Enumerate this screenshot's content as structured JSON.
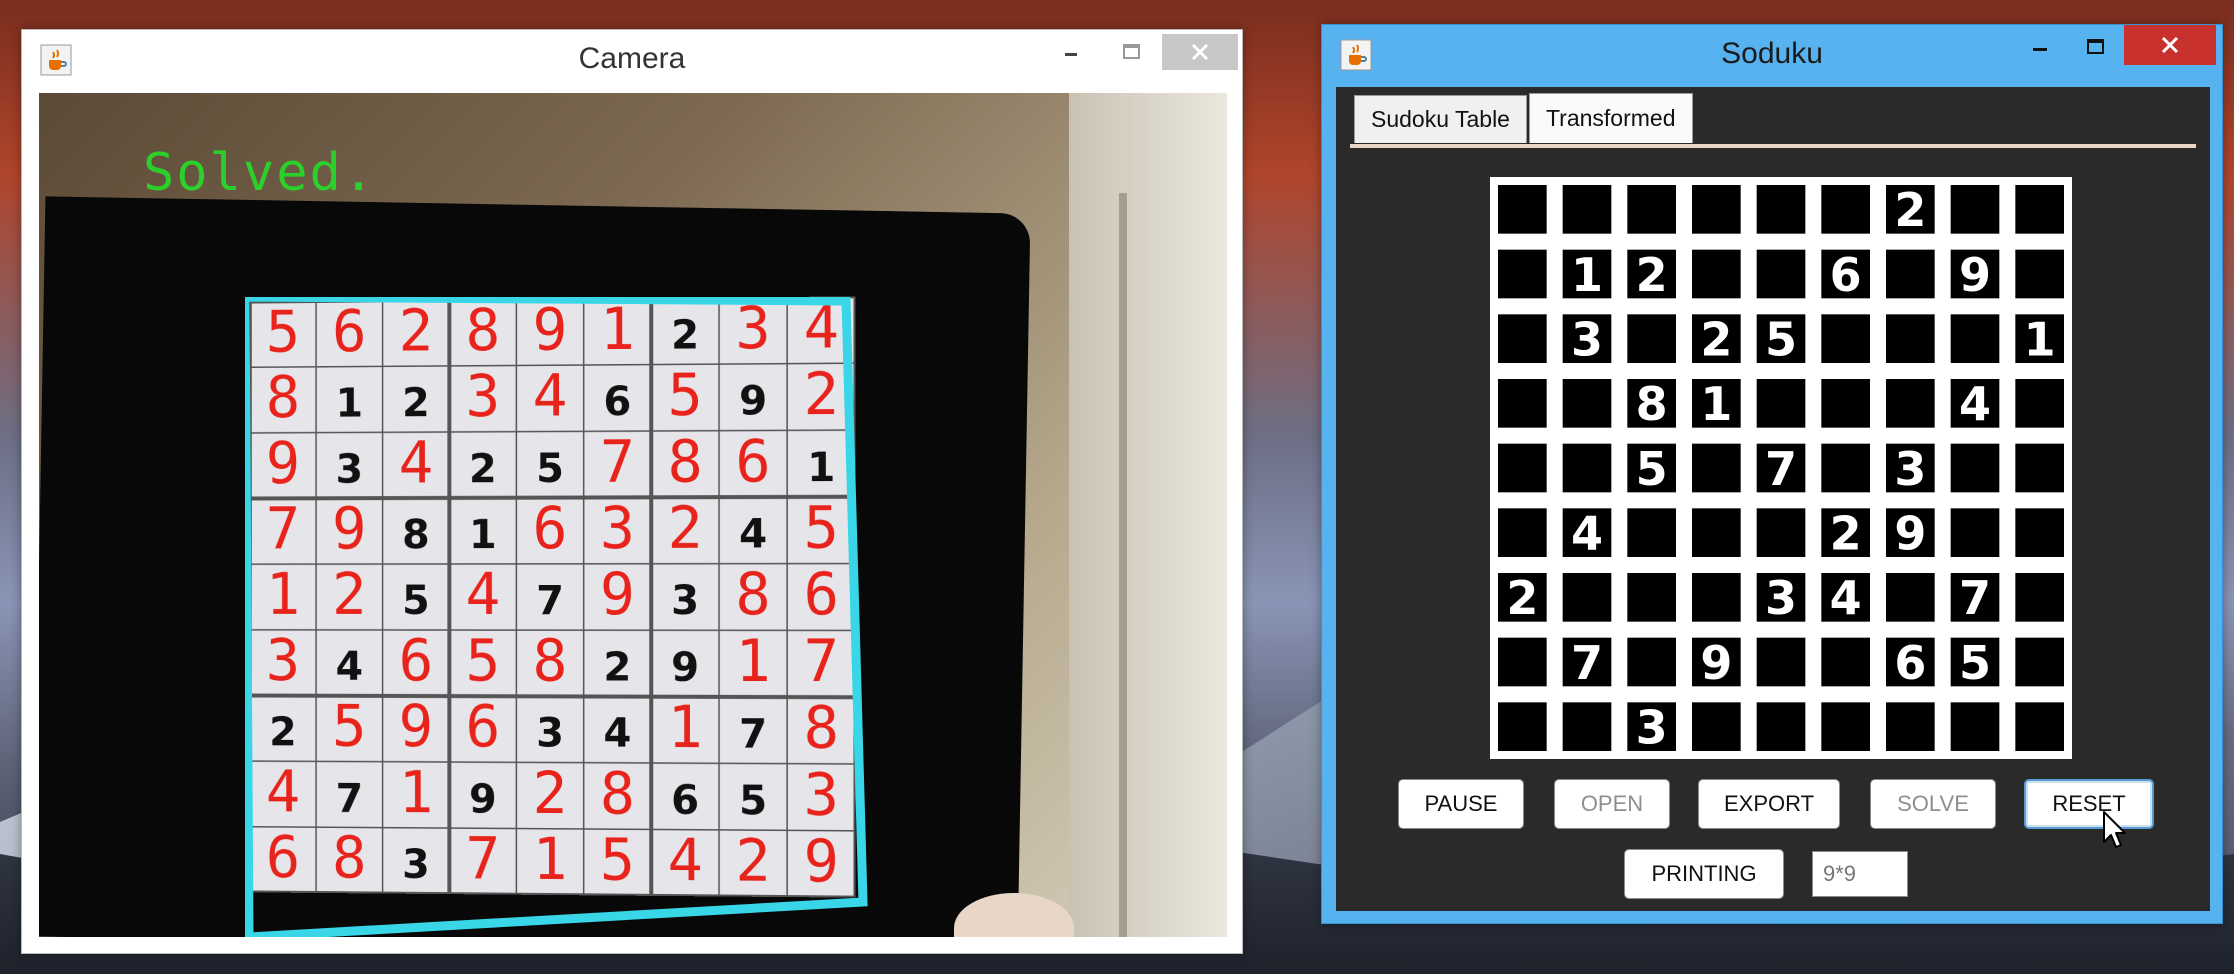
{
  "camera_window": {
    "title": "Camera",
    "overlay_text": "Solved.",
    "sudoku": {
      "printed": [
        [
          "",
          "",
          "",
          "",
          "",
          "",
          "2",
          "",
          ""
        ],
        [
          "",
          "1",
          "2",
          "",
          "",
          "6",
          "",
          "9",
          ""
        ],
        [
          "",
          "3",
          "",
          "2",
          "5",
          "",
          "",
          "",
          "1"
        ],
        [
          "",
          "",
          "8",
          "1",
          "",
          "",
          "",
          "4",
          ""
        ],
        [
          "",
          "",
          "5",
          "",
          "7",
          "",
          "3",
          "",
          ""
        ],
        [
          "",
          "4",
          "",
          "",
          "",
          "2",
          "9",
          "",
          ""
        ],
        [
          "2",
          "",
          "",
          "",
          "3",
          "4",
          "",
          "7",
          ""
        ],
        [
          "",
          "7",
          "",
          "9",
          "",
          "",
          "6",
          "5",
          ""
        ],
        [
          "",
          "",
          "3",
          "",
          "",
          "",
          "",
          "",
          ""
        ]
      ],
      "solution": [
        [
          "5",
          "6",
          "2",
          "8",
          "9",
          "1",
          "2",
          "3",
          "4"
        ],
        [
          "8",
          "1",
          "2",
          "3",
          "4",
          "6",
          "5",
          "9",
          "2"
        ],
        [
          "9",
          "3",
          "4",
          "2",
          "5",
          "7",
          "8",
          "6",
          "1"
        ],
        [
          "7",
          "9",
          "8",
          "1",
          "6",
          "3",
          "2",
          "4",
          "5"
        ],
        [
          "1",
          "2",
          "5",
          "4",
          "7",
          "9",
          "3",
          "8",
          "6"
        ],
        [
          "3",
          "4",
          "6",
          "5",
          "8",
          "2",
          "9",
          "1",
          "7"
        ],
        [
          "2",
          "5",
          "9",
          "6",
          "3",
          "4",
          "1",
          "7",
          "8"
        ],
        [
          "4",
          "7",
          "1",
          "9",
          "2",
          "8",
          "6",
          "5",
          "3"
        ],
        [
          "6",
          "8",
          "3",
          "7",
          "1",
          "5",
          "4",
          "2",
          "9"
        ]
      ],
      "colors": {
        "printed": "#111111",
        "solved": "#e8231c",
        "border": "#39d6e8"
      }
    }
  },
  "sudoku_window": {
    "title": "Soduku",
    "tabs": [
      "Sudoku Table",
      "Transformed"
    ],
    "active_tab": "Transformed",
    "grid": [
      [
        "",
        "",
        "",
        "",
        "",
        "",
        "2",
        "",
        ""
      ],
      [
        "",
        "1",
        "2",
        "",
        "",
        "6",
        "",
        "9",
        ""
      ],
      [
        "",
        "3",
        "",
        "2",
        "5",
        "",
        "",
        "",
        "1"
      ],
      [
        "",
        "",
        "8",
        "1",
        "",
        "",
        "",
        "4",
        ""
      ],
      [
        "",
        "",
        "5",
        "",
        "7",
        "",
        "3",
        "",
        ""
      ],
      [
        "",
        "4",
        "",
        "",
        "",
        "2",
        "9",
        "",
        ""
      ],
      [
        "2",
        "",
        "",
        "",
        "3",
        "4",
        "",
        "7",
        ""
      ],
      [
        "",
        "7",
        "",
        "9",
        "",
        "",
        "6",
        "5",
        ""
      ],
      [
        "",
        "",
        "3",
        "",
        "",
        "",
        "",
        "",
        ""
      ]
    ],
    "buttons": {
      "pause": "PAUSE",
      "open": "OPEN",
      "export": "EXPORT",
      "solve": "SOLVE",
      "reset": "RESET",
      "printing": "PRINTING"
    },
    "size_field_placeholder": "9*9"
  },
  "icons": {
    "app": "java-cup-icon",
    "minimize": "minimize-icon",
    "maximize": "maximize-icon",
    "close": "close-icon",
    "cursor": "mouse-pointer-icon"
  }
}
